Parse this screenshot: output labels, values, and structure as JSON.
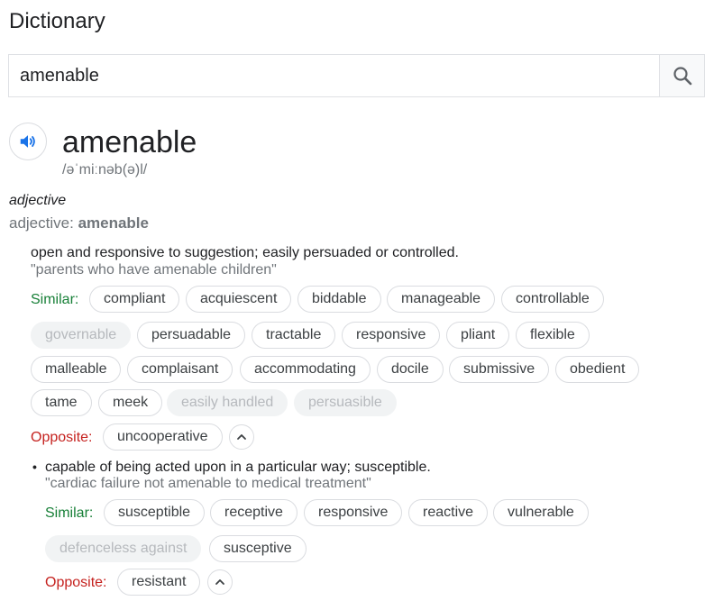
{
  "page": {
    "title": "Dictionary"
  },
  "search": {
    "value": "amenable"
  },
  "entry": {
    "word": "amenable",
    "phonetic": "/əˈmiːnəb(ə)l/",
    "part_of_speech": "adjective",
    "forms_label": "adjective:",
    "forms_word": "amenable"
  },
  "senses": [
    {
      "definition": "open and responsive to suggestion; easily persuaded or controlled.",
      "example": "\"parents who have amenable children\"",
      "similar_label": "Similar:",
      "similar": [
        {
          "text": "compliant",
          "enabled": true
        },
        {
          "text": "acquiescent",
          "enabled": true
        },
        {
          "text": "biddable",
          "enabled": true
        },
        {
          "text": "manageable",
          "enabled": true
        },
        {
          "text": "controllable",
          "enabled": true
        },
        {
          "text": "governable",
          "enabled": false
        },
        {
          "text": "persuadable",
          "enabled": true
        },
        {
          "text": "tractable",
          "enabled": true
        },
        {
          "text": "responsive",
          "enabled": true
        },
        {
          "text": "pliant",
          "enabled": true
        },
        {
          "text": "flexible",
          "enabled": true
        },
        {
          "text": "malleable",
          "enabled": true
        },
        {
          "text": "complaisant",
          "enabled": true
        },
        {
          "text": "accommodating",
          "enabled": true
        },
        {
          "text": "docile",
          "enabled": true
        },
        {
          "text": "submissive",
          "enabled": true
        },
        {
          "text": "obedient",
          "enabled": true
        },
        {
          "text": "tame",
          "enabled": true
        },
        {
          "text": "meek",
          "enabled": true
        },
        {
          "text": "easily handled",
          "enabled": false
        },
        {
          "text": "persuasible",
          "enabled": false
        }
      ],
      "opposite_label": "Opposite:",
      "opposite": [
        {
          "text": "uncooperative",
          "enabled": true
        }
      ]
    },
    {
      "bullet": "•",
      "definition": "capable of being acted upon in a particular way; susceptible.",
      "example": "\"cardiac failure not amenable to medical treatment\"",
      "similar_label": "Similar:",
      "similar": [
        {
          "text": "susceptible",
          "enabled": true
        },
        {
          "text": "receptive",
          "enabled": true
        },
        {
          "text": "responsive",
          "enabled": true
        },
        {
          "text": "reactive",
          "enabled": true
        },
        {
          "text": "vulnerable",
          "enabled": true
        },
        {
          "text": "defenceless against",
          "enabled": false
        },
        {
          "text": "susceptive",
          "enabled": true
        }
      ],
      "opposite_label": "Opposite:",
      "opposite": [
        {
          "text": "resistant",
          "enabled": true
        }
      ]
    }
  ],
  "icons": {
    "search": "search-icon",
    "speaker": "speaker-icon",
    "collapse": "chevron-up-icon"
  },
  "colors": {
    "similar_label": "#188038",
    "opposite_label": "#c5221f",
    "speaker": "#1a73e8",
    "disabled_chip_bg": "#f1f3f4",
    "disabled_chip_text": "#b6b9bd"
  }
}
